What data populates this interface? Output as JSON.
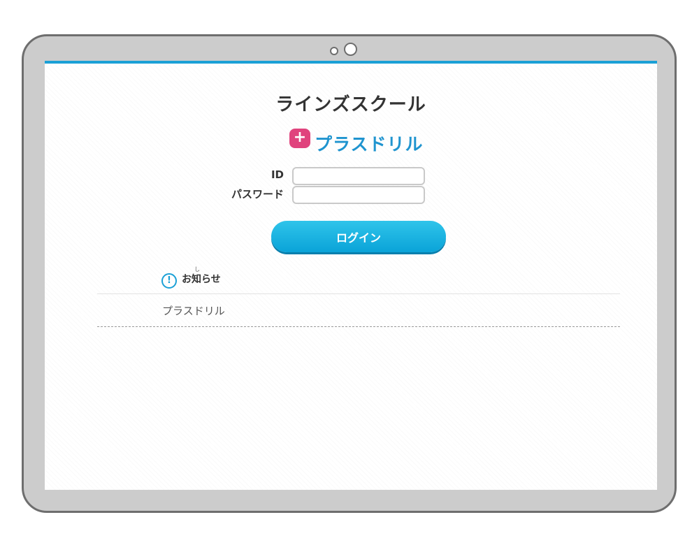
{
  "header": {
    "school_name": "ラインズスクール"
  },
  "logo": {
    "badge_symbol": "+",
    "text": "プラスドリル",
    "colors": {
      "badge": "#e0437d",
      "text": "#1f94cf"
    }
  },
  "login": {
    "id_label": "ID",
    "id_value": "",
    "password_label": "パスワード",
    "password_value": "",
    "button_label": "ログイン",
    "button_color": "#0aa3d8"
  },
  "news": {
    "icon": "exclamation-circle-icon",
    "icon_glyph": "!",
    "title": "お知らせ",
    "ruby": "し",
    "items": [
      {
        "text": "プラスドリル"
      }
    ]
  },
  "theme": {
    "accent": "#1ba0d6",
    "device_frame": "#cccccc"
  }
}
